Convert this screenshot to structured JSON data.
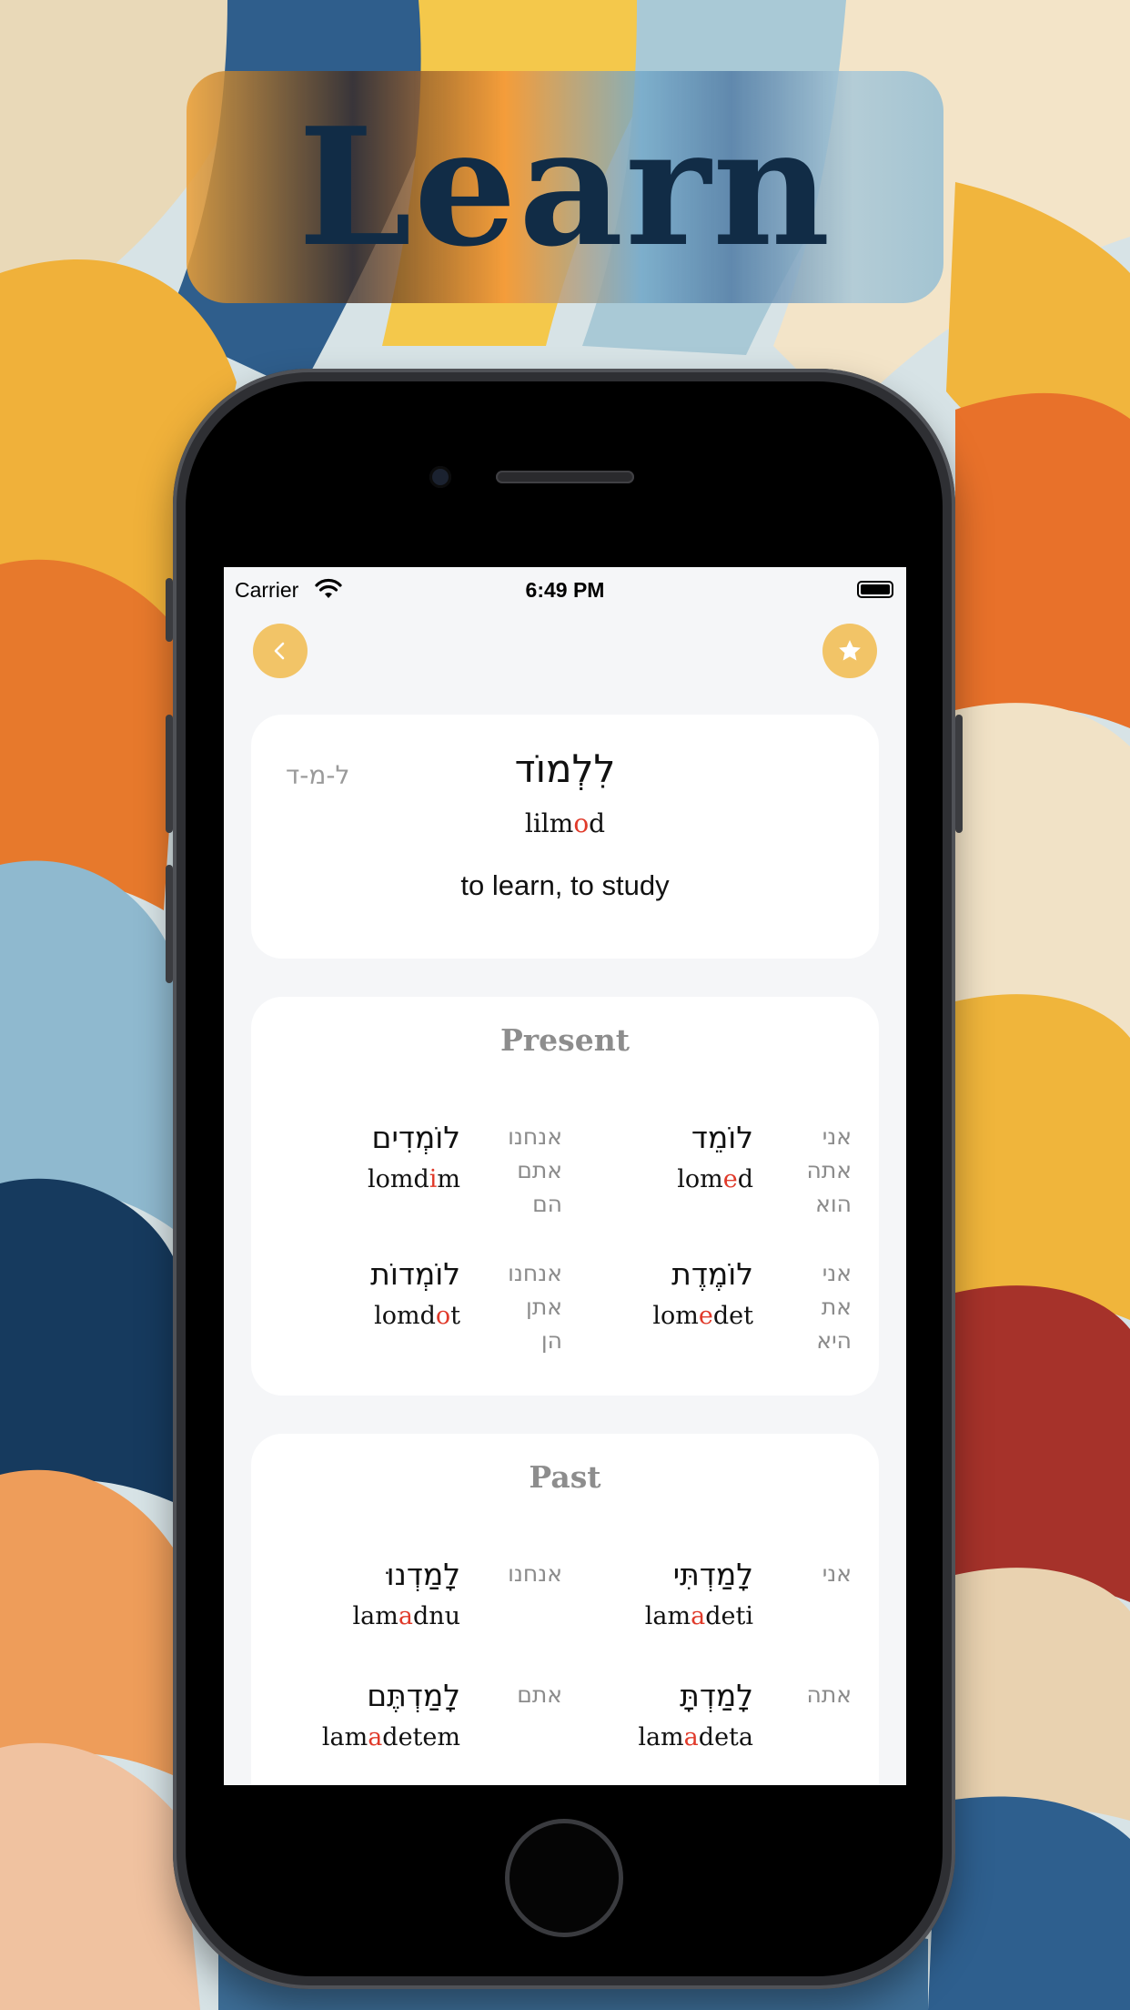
{
  "banner": {
    "title": "Learn"
  },
  "status_bar": {
    "carrier": "Carrier",
    "time": "6:49 PM"
  },
  "nav": {
    "back_icon": "chevron-left-icon",
    "favorite_icon": "star-icon",
    "button_color": "#f2c467"
  },
  "word": {
    "root": "ל-מ-ד",
    "hebrew": "לִלְמוֹד",
    "translit_pre": "lilm",
    "translit_stress": "o",
    "translit_post": "d",
    "meaning": "to learn, to study"
  },
  "present": {
    "title": "Present",
    "forms": [
      {
        "pronouns": [
          "אני",
          "אתה",
          "הוא"
        ],
        "hebrew": "לוֹמֵד",
        "pre": "lom",
        "stress": "e",
        "post": "d"
      },
      {
        "pronouns": [
          "אנחנו",
          "אתם",
          "הם"
        ],
        "hebrew": "לוֹמְדִים",
        "pre": "lomd",
        "stress": "i",
        "post": "m"
      },
      {
        "pronouns": [
          "אני",
          "את",
          "היא"
        ],
        "hebrew": "לוֹמֶדֶת",
        "pre": "lom",
        "stress": "e",
        "post": "det"
      },
      {
        "pronouns": [
          "אנחנו",
          "אתן",
          "הן"
        ],
        "hebrew": "לוֹמְדוֹת",
        "pre": "lomd",
        "stress": "o",
        "post": "t"
      }
    ]
  },
  "past": {
    "title": "Past",
    "forms": [
      {
        "pronouns": [
          "אני"
        ],
        "hebrew": "לָמַדְתִּי",
        "pre": "lam",
        "stress": "a",
        "post": "deti"
      },
      {
        "pronouns": [
          "אנחנו"
        ],
        "hebrew": "לָמַדְנוּ",
        "pre": "lam",
        "stress": "a",
        "post": "dnu"
      },
      {
        "pronouns": [
          "אתה"
        ],
        "hebrew": "לָמַדְתָּ",
        "pre": "lam",
        "stress": "a",
        "post": "deta"
      },
      {
        "pronouns": [
          "אתם"
        ],
        "hebrew": "לָמַדְתֶּם",
        "pre": "lam",
        "stress": "a",
        "post": "detem"
      }
    ]
  },
  "colors": {
    "stress": "#e03a2a",
    "title_text": "#122c45",
    "screen_bg": "#f5f6f8"
  }
}
